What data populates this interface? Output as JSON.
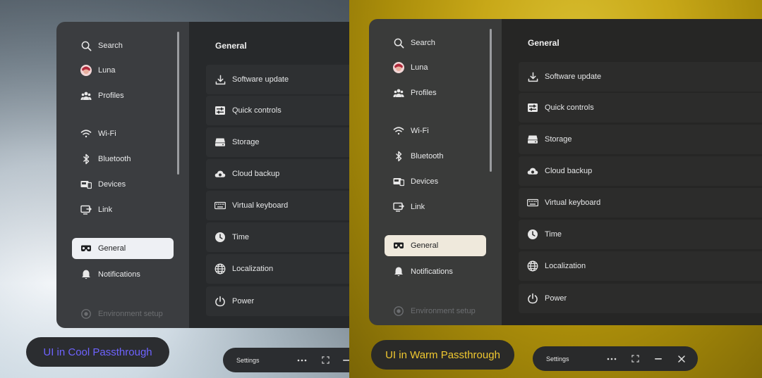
{
  "colors": {
    "cool_accent": "#6e63ff",
    "warm_accent": "#f0c830",
    "active_bg": "#eef0f4"
  },
  "panels": [
    {
      "variant": "cool",
      "caption": "UI in Cool Passthrough",
      "sidebar": {
        "items": [
          {
            "label": "Search",
            "icon": "search-icon"
          },
          {
            "label": "Luna",
            "icon": "avatar"
          },
          {
            "label": "Profiles",
            "icon": "people-icon"
          },
          {
            "label": "Wi-Fi",
            "icon": "wifi-icon"
          },
          {
            "label": "Bluetooth",
            "icon": "bluetooth-icon"
          },
          {
            "label": "Devices",
            "icon": "devices-icon"
          },
          {
            "label": "Link",
            "icon": "link-icon"
          },
          {
            "label": "General",
            "icon": "headset-icon",
            "active": true
          },
          {
            "label": "Notifications",
            "icon": "bell-icon"
          },
          {
            "label": "Environment setup",
            "icon": "environment-icon",
            "dim": true
          }
        ]
      },
      "main": {
        "title": "General",
        "rows": [
          {
            "label": "Software update",
            "icon": "download-icon"
          },
          {
            "label": "Quick controls",
            "icon": "sliders-icon"
          },
          {
            "label": "Storage",
            "icon": "storage-icon"
          },
          {
            "label": "Cloud backup",
            "icon": "cloud-icon"
          },
          {
            "label": "Virtual keyboard",
            "icon": "keyboard-icon"
          },
          {
            "label": "Time",
            "icon": "clock-icon"
          },
          {
            "label": "Localization",
            "icon": "globe-icon"
          },
          {
            "label": "Power",
            "icon": "power-icon"
          }
        ]
      },
      "taskbar": {
        "label": "Settings"
      }
    },
    {
      "variant": "warm",
      "caption": "UI in Warm Passthrough",
      "sidebar": {
        "items": [
          {
            "label": "Search",
            "icon": "search-icon"
          },
          {
            "label": "Luna",
            "icon": "avatar"
          },
          {
            "label": "Profiles",
            "icon": "people-icon"
          },
          {
            "label": "Wi-Fi",
            "icon": "wifi-icon"
          },
          {
            "label": "Bluetooth",
            "icon": "bluetooth-icon"
          },
          {
            "label": "Devices",
            "icon": "devices-icon"
          },
          {
            "label": "Link",
            "icon": "link-icon"
          },
          {
            "label": "General",
            "icon": "headset-icon",
            "active": true
          },
          {
            "label": "Notifications",
            "icon": "bell-icon"
          },
          {
            "label": "Environment setup",
            "icon": "environment-icon",
            "dim": true
          }
        ]
      },
      "main": {
        "title": "General",
        "rows": [
          {
            "label": "Software update",
            "icon": "download-icon"
          },
          {
            "label": "Quick controls",
            "icon": "sliders-icon"
          },
          {
            "label": "Storage",
            "icon": "storage-icon"
          },
          {
            "label": "Cloud backup",
            "icon": "cloud-icon"
          },
          {
            "label": "Virtual keyboard",
            "icon": "keyboard-icon"
          },
          {
            "label": "Time",
            "icon": "clock-icon"
          },
          {
            "label": "Localization",
            "icon": "globe-icon"
          },
          {
            "label": "Power",
            "icon": "power-icon"
          }
        ]
      },
      "taskbar": {
        "label": "Settings"
      }
    }
  ]
}
